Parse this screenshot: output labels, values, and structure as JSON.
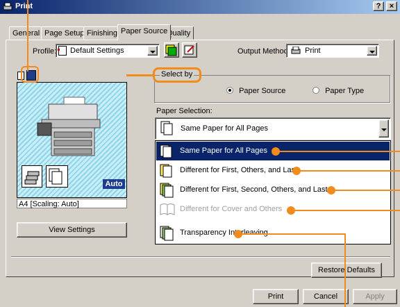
{
  "window": {
    "title": "Print",
    "help_btn": "?",
    "close_btn": "×"
  },
  "tabs": [
    {
      "label": "General"
    },
    {
      "label": "Page Setup"
    },
    {
      "label": "Finishing"
    },
    {
      "label": "Paper Source"
    },
    {
      "label": "Quality"
    }
  ],
  "profile": {
    "label": "Profile:",
    "value": "Default Settings"
  },
  "output": {
    "label": "Output Method:",
    "value": "Print"
  },
  "select_by": {
    "label": "Select by",
    "opt1": "Paper Source",
    "opt2": "Paper Type",
    "selected": "Paper Source"
  },
  "paper_selection": {
    "label": "Paper Selection:",
    "value": "Same Paper for All Pages",
    "options": [
      {
        "label": "Same Paper for All Pages",
        "selected": true
      },
      {
        "label": "Different for First, Others, and Last"
      },
      {
        "label": "Different for First, Second, Others, and Last"
      },
      {
        "label": "Different for Cover and Others",
        "disabled": true
      },
      {
        "label": "Transparency Interleaving"
      }
    ]
  },
  "preview": {
    "auto_badge": "Auto",
    "scaling": "A4 [Scaling: Auto]",
    "view_btn": "View Settings"
  },
  "buttons": {
    "restore": "Restore Defaults",
    "print": "Print",
    "cancel": "Cancel",
    "apply": "Apply"
  },
  "colors": {
    "accent": "#f08b1c",
    "titlebar": "#0a246a",
    "selected_row": "#0a246a"
  }
}
